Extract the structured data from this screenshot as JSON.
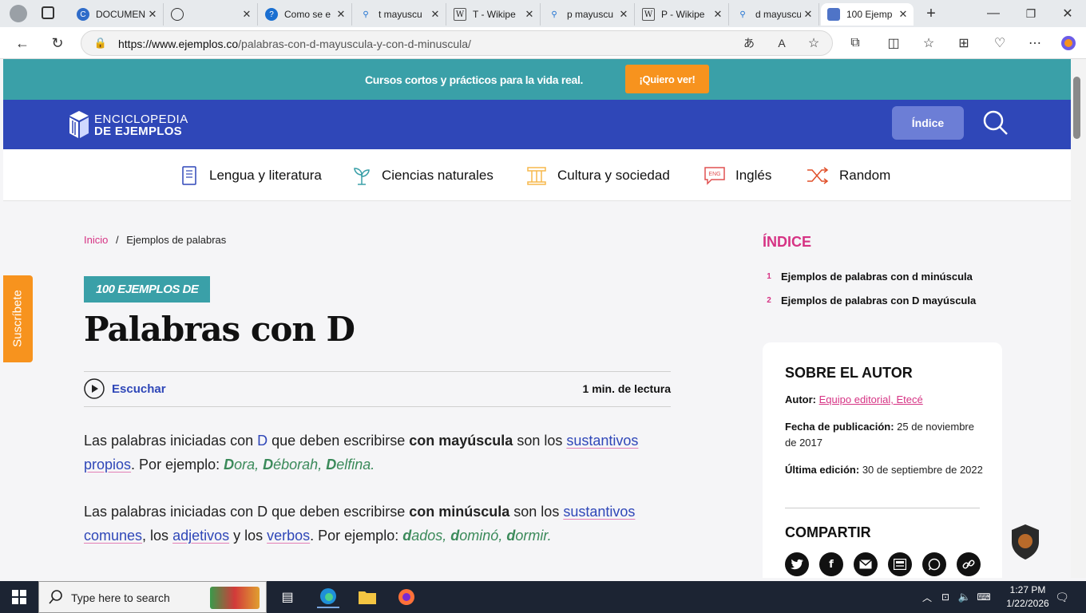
{
  "browser": {
    "tabs": [
      {
        "title": "DOCUMEN",
        "icon": "copilot-icon"
      },
      {
        "title": "",
        "icon": "globe-icon"
      },
      {
        "title": "Como se e",
        "icon": "help-icon"
      },
      {
        "title": "t mayuscu",
        "icon": "search-icon"
      },
      {
        "title": "T - Wikipe",
        "icon": "wikipedia-icon"
      },
      {
        "title": "p mayuscu",
        "icon": "search-icon"
      },
      {
        "title": "P - Wikipe",
        "icon": "wikipedia-icon"
      },
      {
        "title": "d mayuscu",
        "icon": "search-icon"
      },
      {
        "title": "100 Ejemp",
        "icon": "site-icon"
      }
    ],
    "url_domain": "https://www.ejemplos.co",
    "url_path": "/palabras-con-d-mayuscula-y-con-d-minuscula/"
  },
  "promo": {
    "text": "Cursos cortos y prácticos para la vida real.",
    "button": "¡Quiero ver!"
  },
  "header": {
    "logo_line1": "ENCICLOPEDIA",
    "logo_line2": "DE EJEMPLOS",
    "index_button": "Índice"
  },
  "categories": [
    "Lengua y literatura",
    "Ciencias naturales",
    "Cultura y sociedad",
    "Inglés",
    "Random"
  ],
  "category_icon_label": "ENG",
  "subscribe": "Suscríbete",
  "breadcrumb": {
    "home": "Inicio",
    "sep": "/",
    "current": "Ejemplos de palabras"
  },
  "article": {
    "badge": "100 EJEMPLOS DE",
    "title": "Palabras con D",
    "listen": "Escuchar",
    "read_time": "1 min. de lectura",
    "p1": {
      "t1": "Las palabras iniciadas con ",
      "link_d": "D",
      "t2": " que deben escribirse ",
      "b": "con mayúscula",
      "t3": " son los ",
      "link": "sustantivos propios",
      "t4": ". Por ejemplo: ",
      "examples": [
        [
          "D",
          "ora"
        ],
        [
          "D",
          "éborah"
        ],
        [
          "D",
          "elfina."
        ]
      ]
    },
    "p2": {
      "t1": "Las palabras iniciadas con D que deben escribirse ",
      "b": "con minúscula",
      "t2": " son los ",
      "link1": "sustantivos comunes",
      "t3": ", los ",
      "link2": "adjetivos",
      "t4": " y los ",
      "link3": "verbos",
      "t5": ". Por ejemplo: ",
      "examples": [
        [
          "d",
          "ados"
        ],
        [
          "d",
          "ominó"
        ],
        [
          "d",
          "ormir."
        ]
      ]
    }
  },
  "sidebar": {
    "toc_heading": "ÍNDICE",
    "toc": [
      {
        "n": "1",
        "label": "Ejemplos de palabras con d minúscula"
      },
      {
        "n": "2",
        "label": "Ejemplos de palabras con D mayúscula"
      }
    ],
    "author_heading": "SOBRE EL AUTOR",
    "author_label": "Autor:",
    "author_name": "Equipo editorial, Etecé",
    "published_label": "Fecha de publicación:",
    "published": "25 de noviembre de 2017",
    "edited_label": "Última edición:",
    "edited": "30 de septiembre de 2022",
    "share_heading": "COMPARTIR"
  },
  "taskbar": {
    "search_placeholder": "Type here to search",
    "time": "1:27 PM",
    "date": "1/22/2026"
  },
  "colors": {
    "teal": "#3aa0a8",
    "blue": "#2f47b8",
    "orange": "#f7931e",
    "pink": "#d63384",
    "green": "#3b8a5a"
  }
}
